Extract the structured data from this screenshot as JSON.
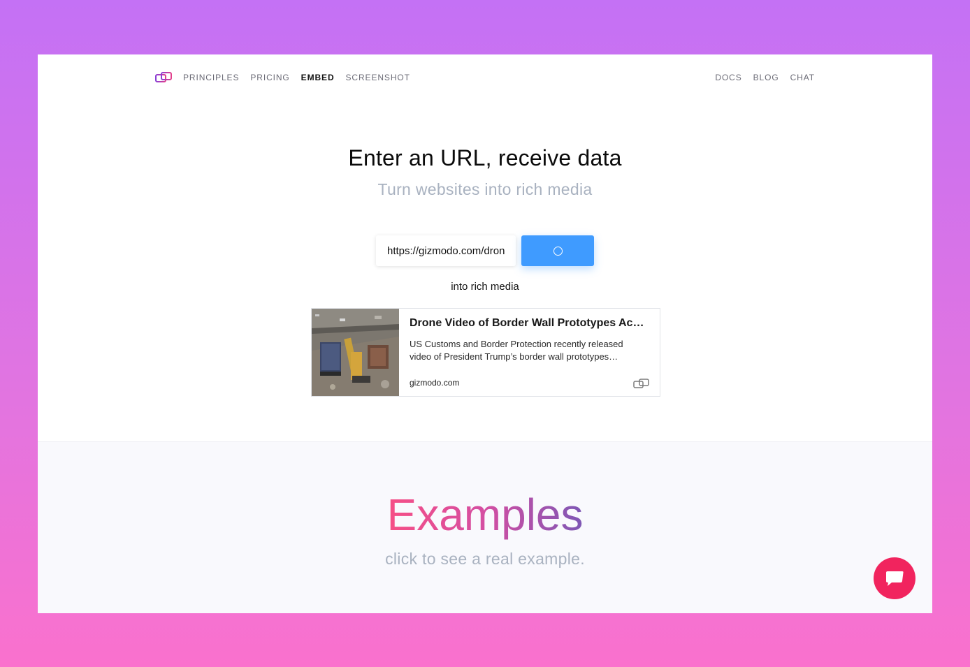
{
  "nav": {
    "left_links": [
      {
        "label": "PRINCIPLES",
        "active": false
      },
      {
        "label": "PRICING",
        "active": false
      },
      {
        "label": "EMBED",
        "active": true
      },
      {
        "label": "SCREENSHOT",
        "active": false
      }
    ],
    "right_links": [
      {
        "label": "DOCS"
      },
      {
        "label": "BLOG"
      },
      {
        "label": "CHAT"
      }
    ]
  },
  "hero": {
    "title": "Enter an URL, receive data",
    "subtitle": "Turn websites into rich media",
    "url_value": "https://gizmodo.com/drone-video-of-border-wall-prototypes",
    "submit_state": "loading",
    "caption": "into rich media"
  },
  "card": {
    "title": "Drone Video of Border Wall Prototypes Ac…",
    "description": "US Customs and Border Protection recently released video of President Trump’s border wall prototypes…",
    "domain": "gizmodo.com"
  },
  "examples": {
    "title": "Examples",
    "subtitle": "click to see a real example."
  },
  "colors": {
    "accent": "#3f9bff",
    "brand_logo": "#c13fa8",
    "chat": "#f1245e",
    "muted_text": "#a9b2c0"
  },
  "icons": {
    "logo": "microlink-logo-icon",
    "spinner": "loading-spinner-icon",
    "chat": "chat-bubble-icon"
  }
}
